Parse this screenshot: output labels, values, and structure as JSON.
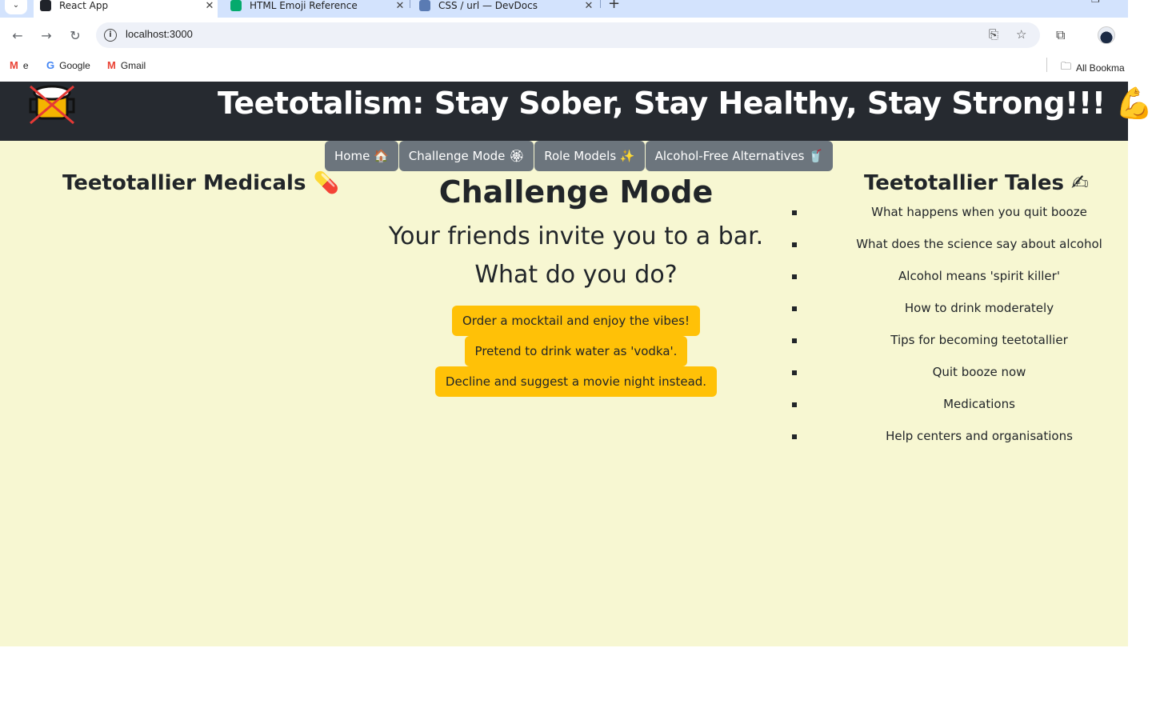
{
  "browser": {
    "tabs": [
      {
        "title": "React App",
        "active": true
      },
      {
        "title": "HTML Emoji Reference",
        "active": false
      },
      {
        "title": "CSS / url — DevDocs",
        "active": false
      }
    ],
    "url": "localhost:3000",
    "bookmarks": [
      {
        "label": "e"
      },
      {
        "label": "Google"
      },
      {
        "label": "Gmail"
      }
    ],
    "all_bookmarks_label": "All Bookma"
  },
  "header": {
    "title": "Teetotalism: Stay Sober, Stay Healthy, Stay Strong!!! 💪"
  },
  "nav": [
    {
      "label": "Home 🏠"
    },
    {
      "label": "Challenge Mode 🏵"
    },
    {
      "label": "Role Models ✨"
    },
    {
      "label": "Alcohol-Free Alternatives 🥤"
    }
  ],
  "left": {
    "heading": "Teetotallier Medicals 💊"
  },
  "challenge": {
    "title": "Challenge Mode",
    "question": "Your friends invite you to a bar. What do you do?",
    "choices": [
      "Order a mocktail and enjoy the vibes!",
      "Pretend to drink water as 'vodka'.",
      "Decline and suggest a movie night instead."
    ]
  },
  "right": {
    "heading": "Teetotallier Tales ✍",
    "items": [
      "What happens when you quit booze",
      "What does the science say about alcohol",
      "Alcohol means 'spirit killer'",
      "How to drink moderately",
      "Tips for becoming teetotallier",
      "Quit booze now",
      "Medications",
      "Help centers and organisations"
    ]
  },
  "colors": {
    "header_bg": "#262a30",
    "page_bg": "#f7f7d2",
    "nav_btn": "#6c757d",
    "choice_btn": "#ffc107",
    "browser_tabstrip": "#d3e3fd"
  }
}
